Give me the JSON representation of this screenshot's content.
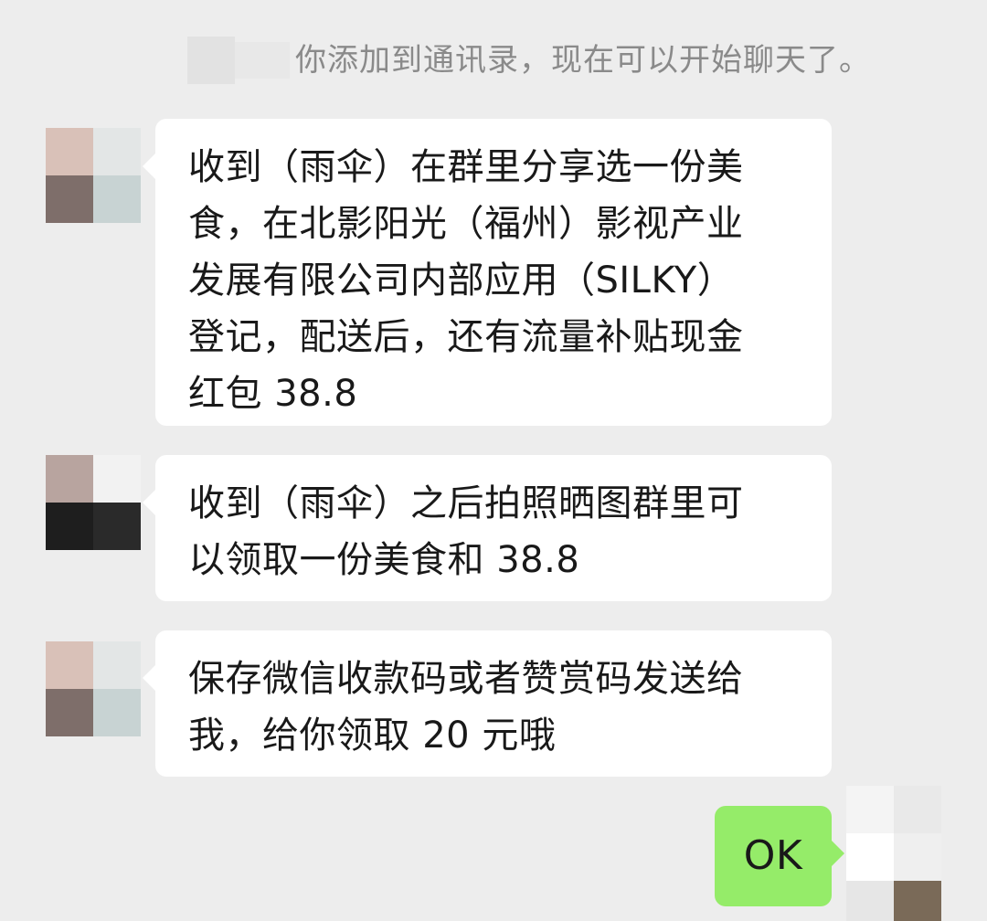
{
  "system_notice": {
    "text": "你添加到通讯录，现在可以开始聊天了。"
  },
  "messages": [
    {
      "side": "left",
      "lines": [
        "收到（雨伞）在群里分享选一份美",
        "食，在北影阳光（福州）影视产业",
        "发展有限公司内部应用（SILKY）",
        "登记，配送后，还有流量补贴现金",
        "红包 38.8"
      ]
    },
    {
      "side": "left",
      "lines": [
        "收到（雨伞）之后拍照晒图群里可",
        "以领取一份美食和 38.8"
      ]
    },
    {
      "side": "left",
      "lines": [
        "保存微信收款码或者赞赏码发送给",
        "我，给你领取 20 元哦"
      ]
    },
    {
      "side": "right",
      "lines": [
        "OK"
      ]
    }
  ],
  "colors": {
    "background": "#ededed",
    "incoming_bubble": "#ffffff",
    "outgoing_bubble": "#95ec69",
    "system_text": "#8a8a8a"
  }
}
